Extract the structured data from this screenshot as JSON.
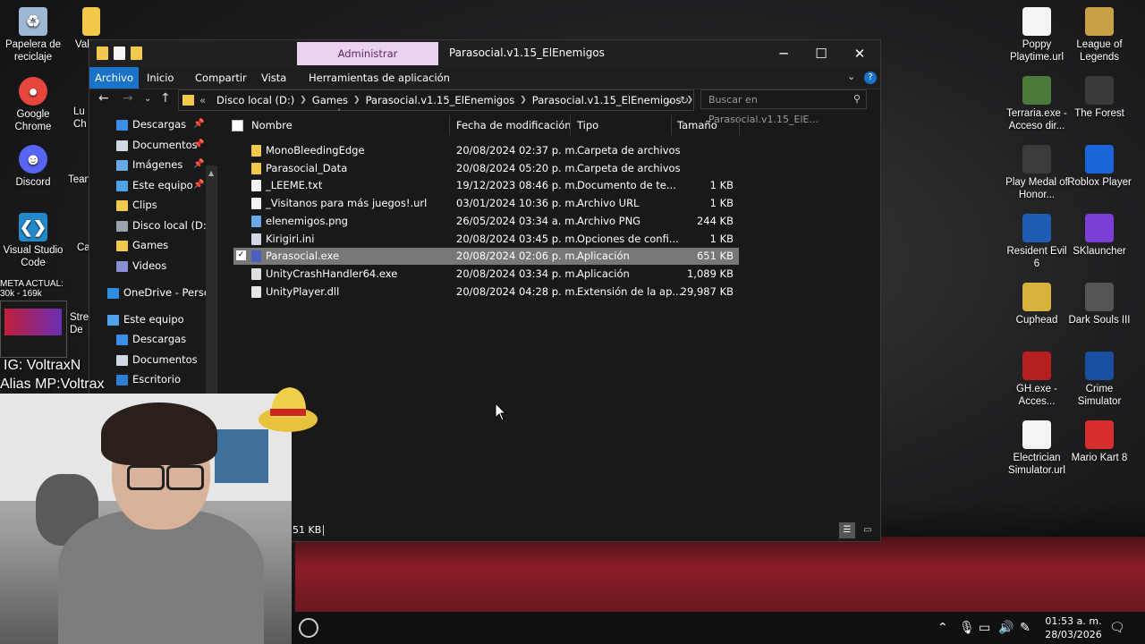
{
  "desktop": {
    "left_icons": [
      {
        "label": "Papelera de reciclaje",
        "icon": "recycle-bin-icon",
        "color": "#9fb8d6"
      },
      {
        "label": "Google Chrome",
        "icon": "chrome-icon",
        "color": "#e8453c"
      },
      {
        "label": "Discord",
        "icon": "discord-icon",
        "color": "#5865f2"
      },
      {
        "label": "Visual Studio Code",
        "icon": "vscode-icon",
        "color": "#2489ca"
      }
    ],
    "partial_icons": [
      {
        "label": "Val",
        "icon": "folder-icon"
      },
      {
        "label": "Lu",
        "icon": "app-icon"
      },
      {
        "label": "Ch",
        "icon": "app-icon"
      },
      {
        "label": "Tean",
        "icon": "teams-icon"
      },
      {
        "label": "Ca",
        "icon": "app-icon"
      },
      {
        "label": "Strea",
        "icon": "app-icon"
      },
      {
        "label": "De",
        "icon": "app-icon"
      }
    ],
    "right_icons_col1": [
      {
        "label": "Poppy Playtime.url",
        "icon": "document-icon",
        "color": "#f4f4f4"
      },
      {
        "label": "Terraria.exe - Acceso dir...",
        "icon": "terraria-icon",
        "color": "#4a7a3a"
      },
      {
        "label": "Play Medal of Honor...",
        "icon": "medal-icon",
        "color": "#3b3b3b"
      },
      {
        "label": "Resident Evil 6",
        "icon": "resident-evil-icon",
        "color": "#1f5db5"
      },
      {
        "label": "Cuphead",
        "icon": "cuphead-icon",
        "color": "#d9b23c"
      },
      {
        "label": "GH.exe - Acces...",
        "icon": "gh-icon",
        "color": "#b51f1f"
      },
      {
        "label": "Electrician Simulator.url",
        "icon": "document-icon",
        "color": "#f4f4f4"
      }
    ],
    "right_icons_col2": [
      {
        "label": "League of Legends",
        "icon": "lol-icon",
        "color": "#c8a046"
      },
      {
        "label": "The Forest",
        "icon": "forest-icon",
        "color": "#3a3a3a"
      },
      {
        "label": "Roblox Player",
        "icon": "roblox-icon",
        "color": "#1a66d9"
      },
      {
        "label": "SKlauncher",
        "icon": "sklauncher-icon",
        "color": "#7a3fd6"
      },
      {
        "label": "Dark Souls III",
        "icon": "dark-souls-icon",
        "color": "#555"
      },
      {
        "label": "Crime Simulator",
        "icon": "crime-icon",
        "color": "#1a4fa0"
      },
      {
        "label": "Mario Kart 8",
        "icon": "mario-kart-icon",
        "color": "#d92e2e"
      }
    ]
  },
  "window": {
    "manage_tab": "Administrar",
    "title": "Parasocial.v1.15_ElEnemigos",
    "controls": {
      "minimize": "─",
      "maximize": "☐",
      "close": "✕"
    },
    "ribbon_tabs": [
      "Archivo",
      "Inicio",
      "Compartir",
      "Vista",
      "Herramientas de aplicación"
    ],
    "address": {
      "segments": [
        "Disco local (D:)",
        "Games",
        "Parasocial.v1.15_ElEnemigos",
        "Parasocial.v1.15_ElEnemigos"
      ],
      "overflow": "«"
    },
    "search_placeholder": "Buscar en Parasocial.v1.15_ElE...",
    "sidebar": [
      {
        "label": "Descargas",
        "icon": "download-icon",
        "color": "#3b8ee8",
        "pinned": true
      },
      {
        "label": "Documentos",
        "icon": "documents-icon",
        "color": "#cfd8e3",
        "pinned": true
      },
      {
        "label": "Imágenes",
        "icon": "pictures-icon",
        "color": "#6aa9e8",
        "pinned": true
      },
      {
        "label": "Este equipo",
        "icon": "computer-icon",
        "color": "#4fa3e8",
        "pinned": true
      },
      {
        "label": "Clips",
        "icon": "folder-icon",
        "color": "#f2c94c",
        "pinned": false
      },
      {
        "label": "Disco local (D:)",
        "icon": "drive-icon",
        "color": "#9aa3ad",
        "pinned": false
      },
      {
        "label": "Games",
        "icon": "folder-icon",
        "color": "#f2c94c",
        "pinned": false
      },
      {
        "label": "Videos",
        "icon": "videos-icon",
        "color": "#8b8fd6",
        "pinned": false
      },
      {
        "label": "OneDrive - Person",
        "icon": "onedrive-icon",
        "color": "#2d8ee0",
        "pinned": false
      },
      {
        "label": "Este equipo",
        "icon": "computer-icon",
        "color": "#4fa3e8",
        "pinned": false
      },
      {
        "label": "Descargas",
        "icon": "download-icon",
        "color": "#3b8ee8",
        "pinned": false
      },
      {
        "label": "Documentos",
        "icon": "documents-icon",
        "color": "#cfd8e3",
        "pinned": false
      },
      {
        "label": "Escritorio",
        "icon": "desktop-icon",
        "color": "#2d7fd6",
        "pinned": false
      }
    ],
    "columns": {
      "name": "Nombre",
      "date": "Fecha de modificación",
      "type": "Tipo",
      "size": "Tamaño"
    },
    "files": [
      {
        "name": "MonoBleedingEdge",
        "date": "20/08/2024 02:37 p. m.",
        "type": "Carpeta de archivos",
        "size": "",
        "icon": "folder-icon",
        "color": "#f2c94c"
      },
      {
        "name": "Parasocial_Data",
        "date": "20/08/2024 05:20 p. m.",
        "type": "Carpeta de archivos",
        "size": "",
        "icon": "folder-icon",
        "color": "#f2c94c"
      },
      {
        "name": "_LEEME.txt",
        "date": "19/12/2023 08:46 p. m.",
        "type": "Documento de te...",
        "size": "1 KB",
        "icon": "text-file-icon",
        "color": "#f4f4f4"
      },
      {
        "name": "_Visitanos para más juegos!.url",
        "date": "03/01/2024 10:36 p. m.",
        "type": "Archivo URL",
        "size": "1 KB",
        "icon": "url-file-icon",
        "color": "#f4f4f4"
      },
      {
        "name": "elenemigos.png",
        "date": "26/05/2024 03:34 a. m.",
        "type": "Archivo PNG",
        "size": "244 KB",
        "icon": "image-file-icon",
        "color": "#6aa9e8"
      },
      {
        "name": "Kirigiri.ini",
        "date": "20/08/2024 03:45 p. m.",
        "type": "Opciones de confi...",
        "size": "1 KB",
        "icon": "ini-file-icon",
        "color": "#cfd8e3"
      },
      {
        "name": "Parasocial.exe",
        "date": "20/08/2024 02:06 p. m.",
        "type": "Aplicación",
        "size": "651 KB",
        "icon": "exe-icon",
        "color": "#4a5fc0",
        "selected": true
      },
      {
        "name": "UnityCrashHandler64.exe",
        "date": "20/08/2024 03:34 p. m.",
        "type": "Aplicación",
        "size": "1,089 KB",
        "icon": "unity-icon",
        "color": "#e0e0e0"
      },
      {
        "name": "UnityPlayer.dll",
        "date": "20/08/2024 04:28 p. m.",
        "type": "Extensión de la ap...",
        "size": "29,987 KB",
        "icon": "dll-file-icon",
        "color": "#e8e8e8"
      }
    ],
    "status_text": "51 KB"
  },
  "stream_overlay": {
    "meta_line1": "META ACTUAL:",
    "meta_line2": "30k - 169k",
    "ig": "IG: VoltraxN",
    "alias": "Alias MP:Voltrax"
  },
  "taskbar": {
    "time": "01:53 a. m.",
    "date": "28/03/2026",
    "tray_icons": [
      "chevron-up-icon",
      "microphone-icon",
      "network-icon",
      "volume-icon",
      "pen-icon"
    ]
  }
}
